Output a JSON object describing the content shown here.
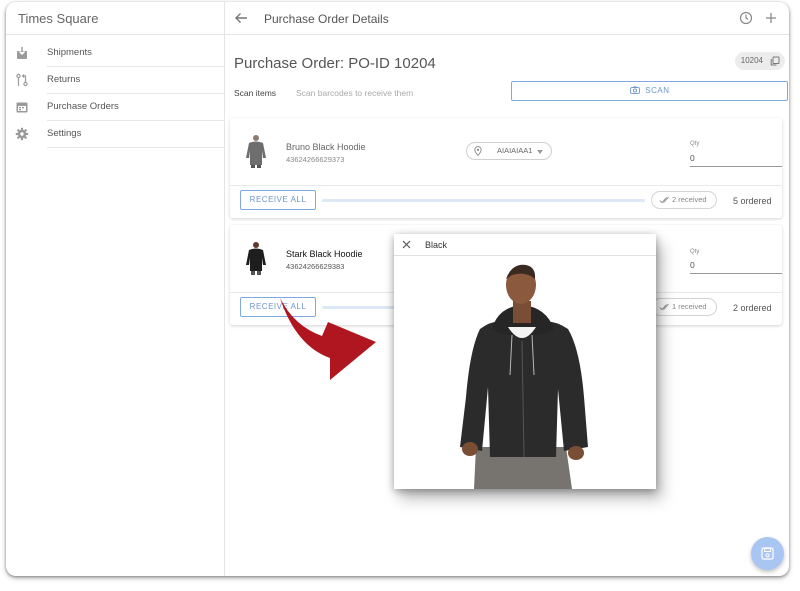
{
  "app": {
    "name": "Times Square"
  },
  "sidebar": {
    "items": [
      {
        "label": "Shipments",
        "icon": "shipment-icon"
      },
      {
        "label": "Returns",
        "icon": "returns-icon"
      },
      {
        "label": "Purchase Orders",
        "icon": "calendar-icon"
      },
      {
        "label": "Settings",
        "icon": "gear-icon"
      }
    ]
  },
  "header": {
    "title": "Purchase Order Details"
  },
  "order": {
    "title": "Purchase Order: PO-ID 10204",
    "id_chip": "10204"
  },
  "scan": {
    "label": "Scan items",
    "hint": "Scan barcodes to receive them",
    "button_label": "SCAN"
  },
  "items": [
    {
      "name": "Bruno Black Hoodie",
      "sku": "43624266629373",
      "location": "AIAIAIAA1",
      "qty_label": "Qty",
      "qty": "0",
      "receive_all_label": "RECEIVE ALL",
      "received": "2 received",
      "ordered": "5 ordered"
    },
    {
      "name": "Stark Black Hoodie",
      "sku": "43624266629383",
      "qty_label": "Qty",
      "qty": "0",
      "receive_all_label": "RECEIVE ALL",
      "received": "1 received",
      "ordered": "2 ordered"
    }
  ],
  "popup": {
    "title": "Black"
  },
  "colors": {
    "accent": "#6c94cf",
    "accent_border": "#7ea7e3",
    "arrow": "#b01620",
    "fab": "#a9c6f2"
  }
}
